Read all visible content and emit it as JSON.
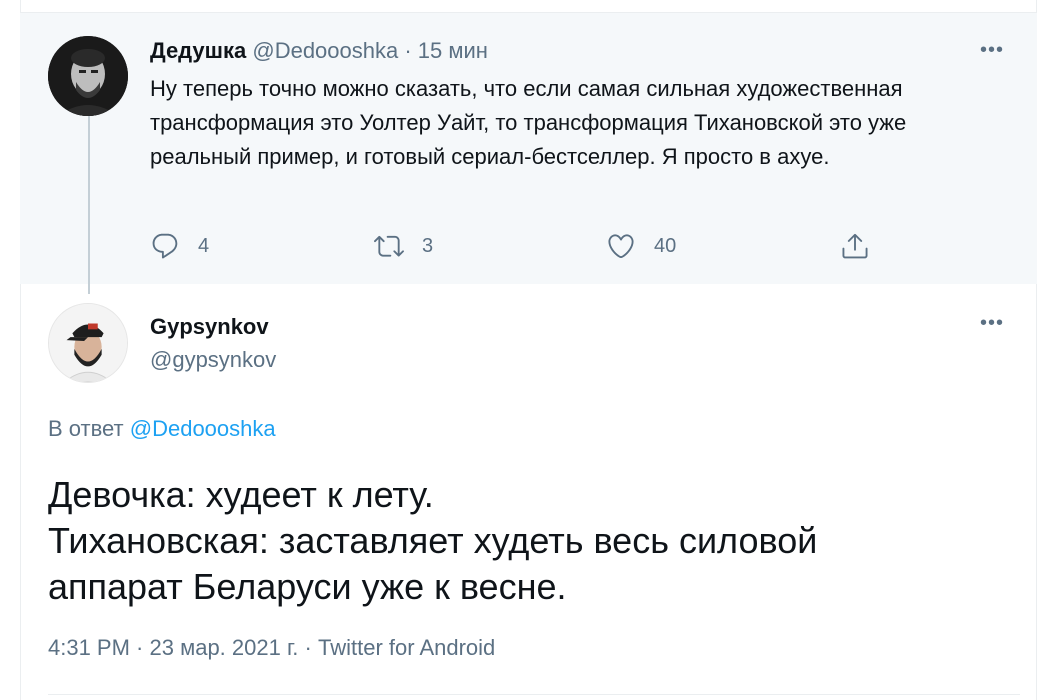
{
  "parent_tweet": {
    "author_name": "Дедушка",
    "author_handle": "@Dedoooshka",
    "separator": " · ",
    "time": "15 мин",
    "text": "Ну теперь точно можно сказать, что если самая сильная художественная трансформация это Уолтер Уайт, то трансформация Тихановской это уже реальный пример, и готовый сериал-бестселлер. Я просто в ахуе.",
    "more_label": "•••",
    "actions": {
      "reply_icon": "reply-icon",
      "reply_count": "4",
      "retweet_icon": "retweet-icon",
      "retweet_count": "3",
      "like_icon": "heart-icon",
      "like_count": "40",
      "share_icon": "share-icon"
    }
  },
  "main_tweet": {
    "author_name": "Gypsynkov",
    "author_handle": "@gypsynkov",
    "more_label": "•••",
    "reply_prefix": "В ответ ",
    "reply_mention": "@Dedoooshka",
    "text_lines": [
      "Девочка: худеет к лету.",
      "Тихановская: заставляет худеть весь силовой",
      "аппарат Беларуси уже к весне."
    ],
    "meta": {
      "time": "4:31 PM",
      "sep1": " · ",
      "date": "23 мар. 2021 г.",
      "sep2": " · ",
      "source": "Twitter for Android"
    }
  },
  "colors": {
    "accent": "#1da1f2",
    "secondary_text": "#5b7083",
    "parent_background": "#f5f8fa"
  }
}
